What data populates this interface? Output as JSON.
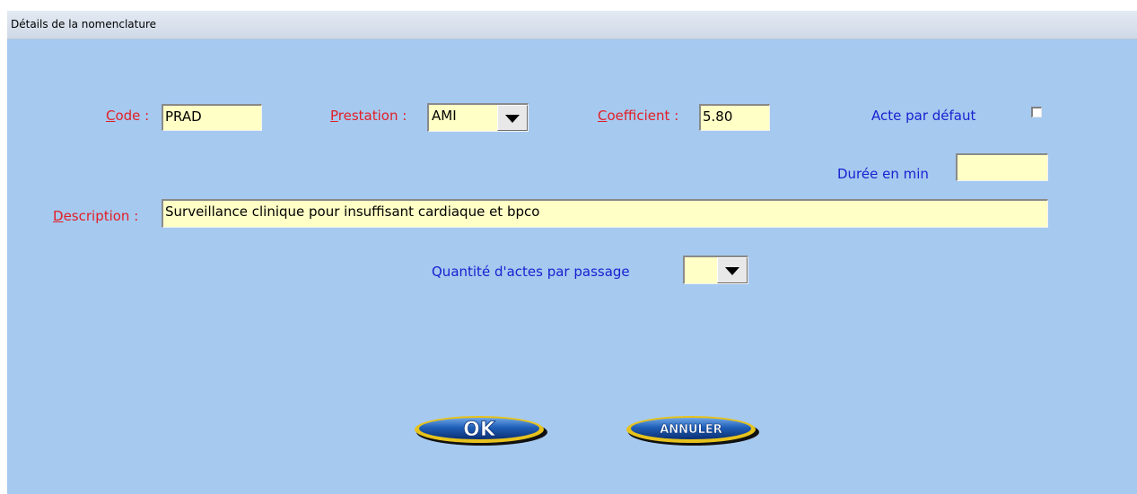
{
  "window": {
    "title": "Détails de la nomenclature"
  },
  "form": {
    "code": {
      "accel": "C",
      "rest": "ode :",
      "value": "PRAD"
    },
    "prestation": {
      "accel": "P",
      "rest": "restation :",
      "value": "AMI"
    },
    "coefficient": {
      "accel": "C",
      "rest": "oefficient :",
      "value": "5.80"
    },
    "acte_defaut": {
      "label": "Acte par défaut",
      "checked": false
    },
    "duree": {
      "label": "Durée en min",
      "value": ""
    },
    "description": {
      "accel": "D",
      "rest": "escription :",
      "value": "Surveillance clinique pour insuffisant cardiaque et bpco"
    },
    "quantite": {
      "label": "Quantité d'actes par passage",
      "value": ""
    }
  },
  "buttons": {
    "ok": "OK",
    "cancel": "ANNULER"
  },
  "colors": {
    "background": "#a6c9ef",
    "field": "#ffffc6",
    "required_label": "#e21f26",
    "optional_label": "#1822d0"
  }
}
